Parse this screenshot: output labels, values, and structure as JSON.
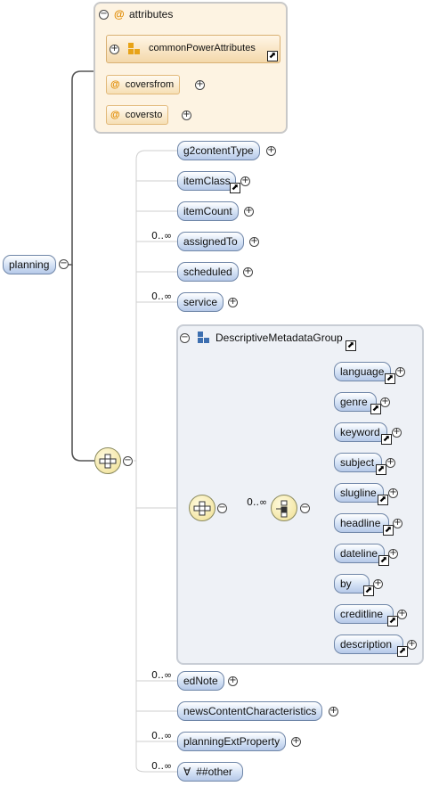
{
  "root": {
    "label": "planning"
  },
  "attributes": {
    "header": "attributes",
    "group_ref": "commonPowerAttributes",
    "items": [
      "coversfrom",
      "coversto"
    ]
  },
  "sequence_elements": [
    {
      "label": "g2contentType",
      "occurs": ""
    },
    {
      "label": "itemClass",
      "occurs": ""
    },
    {
      "label": "itemCount",
      "occurs": ""
    },
    {
      "label": "assignedTo",
      "occurs": "0..∞"
    },
    {
      "label": "scheduled",
      "occurs": ""
    },
    {
      "label": "service",
      "occurs": "0..∞"
    }
  ],
  "descriptive_group": {
    "label": "DescriptiveMetadataGroup",
    "choice_occurs": "0..∞",
    "items": [
      "language",
      "genre",
      "keyword",
      "subject",
      "slugline",
      "headline",
      "dateline",
      "by",
      "creditline",
      "description"
    ]
  },
  "tail_elements": [
    {
      "label": "edNote",
      "occurs": "0..∞"
    },
    {
      "label": "newsContentCharacteristics",
      "occurs": ""
    },
    {
      "label": "planningExtProperty",
      "occurs": "0..∞"
    },
    {
      "label": "##other",
      "occurs": "0..∞"
    }
  ],
  "icons": {
    "expand": "plus-circle-icon",
    "collapse": "minus-circle-icon",
    "reference": "reference-arrow-icon",
    "attribute": "at-sign-icon",
    "attribute_group": "attribute-group-icon",
    "sequence": "sequence-compositor-icon",
    "choice": "choice-compositor-icon",
    "any": "wildcard-icon"
  },
  "colors": {
    "element_fill": "#c9d9f2",
    "element_border": "#6f86a8",
    "attribute_fill": "#fdf3e2",
    "attribute_border": "#e2b97a",
    "compositor_fill": "#f4e7a8",
    "line": "#555555"
  }
}
